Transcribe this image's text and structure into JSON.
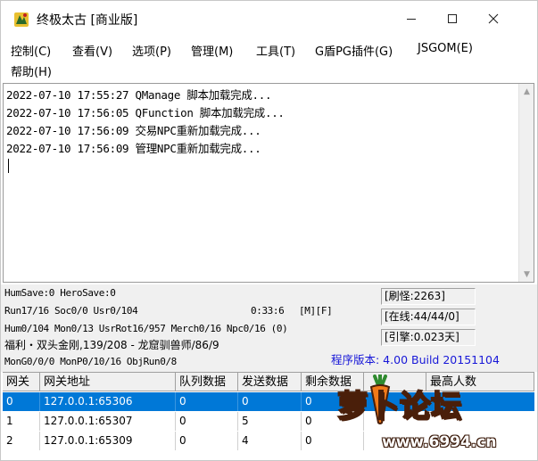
{
  "window": {
    "title": "终极太古 [商业版]",
    "controls": {
      "minimize": "─",
      "maximize": "☐",
      "close": "✕"
    }
  },
  "menu": {
    "items": [
      "控制(C)",
      "查看(V)",
      "选项(P)",
      "管理(M)",
      "工具(T)",
      "G盾PG插件(G)",
      "JSGOM(E)",
      "帮助(H)"
    ]
  },
  "log": {
    "lines": [
      "2022-07-10 17:55:27 QManage 脚本加载完成...",
      "2022-07-10 17:56:05 QFunction 脚本加载完成...",
      "2022-07-10 17:56:09 交易NPC重新加载完成...",
      "2022-07-10 17:56:09 管理NPC重新加载完成..."
    ]
  },
  "status": {
    "line1": "HumSave:0 HeroSave:0",
    "line2": "Run17/16 Soc0/0 Usr0/104",
    "timer": "0:33:6",
    "flags": "[M][F]",
    "line3": "Hum0/104 Mon0/13 UsrRot16/957 Merch0/16 Npc0/16 (0)",
    "line4": "福利・双头金刚,139/208 - 龙窟驯兽师/86/9",
    "line5": "MonG0/0/0 MonP0/10/16 ObjRun0/8",
    "refresh": "[刷怪:2263]",
    "online": "[在线:44/44/0]",
    "engine": "[引擎:0.023天]",
    "version": "程序版本: 4.00 Build 20151104"
  },
  "table": {
    "headers": [
      "网关",
      "网关地址",
      "队列数据",
      "发送数据",
      "剩余数据",
      "",
      "最高人数"
    ],
    "rows": [
      {
        "id": "0",
        "address": "127.0.0.1:65306",
        "queue": "0",
        "sent": "0",
        "remain": "0",
        "extra": "",
        "max": "",
        "selected": true
      },
      {
        "id": "1",
        "address": "127.0.0.1:65307",
        "queue": "0",
        "sent": "5",
        "remain": "0",
        "extra": "",
        "max": "",
        "selected": false
      },
      {
        "id": "2",
        "address": "127.0.0.1:65309",
        "queue": "0",
        "sent": "4",
        "remain": "0",
        "extra": "",
        "max": "",
        "selected": false
      }
    ]
  },
  "watermark": {
    "text": "萝卜论坛",
    "url": "www.6994.cn"
  },
  "colors": {
    "selection": "#0078d7",
    "version_text": "#1818d8",
    "panel_bg": "#f0f0f0"
  }
}
